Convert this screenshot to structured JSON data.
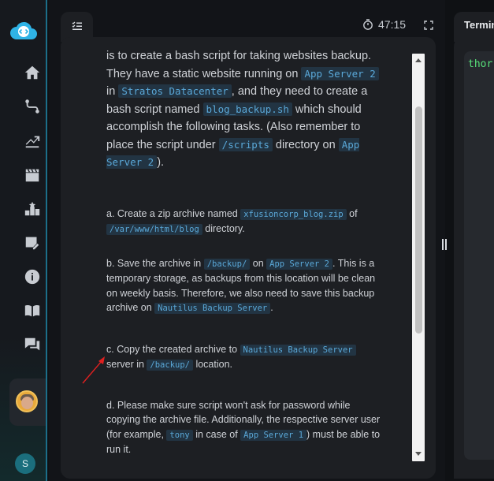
{
  "header": {
    "timer": "47:15",
    "terminal_tab_label": "Terminal"
  },
  "terminal": {
    "prompt_fragment": "thor"
  },
  "sidebar": {
    "user_initial": "S",
    "icons": [
      "home-icon",
      "route-icon",
      "chart-icon",
      "clapperboard-icon",
      "leaderboard-icon",
      "notes-icon",
      "info-icon",
      "book-icon",
      "chat-icon"
    ]
  },
  "task": {
    "intro": {
      "t1": "is to create a bash script for taking websites backup. They have a static website running on ",
      "c1": "App Server 2",
      "t2": " in ",
      "c2": "Stratos Datacenter",
      "t3": ", and they need to create a bash script named ",
      "c3": "blog_backup.sh",
      "t4": " which should accomplish the following tasks. (Also remember to place the script under ",
      "c4": "/scripts",
      "t5": " directory on ",
      "c5": "App Server 2",
      "t6": ")."
    },
    "a": {
      "t1": "a. Create a zip archive named ",
      "c1": "xfusioncorp_blog.zip",
      "t2": " of ",
      "c2": "/var/www/html/blog",
      "t3": " directory."
    },
    "b": {
      "t1": "b. Save the archive in ",
      "c1": "/backup/",
      "t2": " on ",
      "c2": "App Server 2",
      "t3": ". This is a temporary storage, as backups from this location will be clean on weekly basis. Therefore, we also need to save this backup archive on ",
      "c3": "Nautilus Backup Server",
      "t4": "."
    },
    "c": {
      "t1": "c. Copy the created archive to ",
      "c1": "Nautilus Backup Server",
      "t2": " server in ",
      "c2": "/backup/",
      "t3": " location."
    },
    "d": {
      "t1": "d. Please make sure script won't ask for password while copying the archive file. Additionally, the respective server user (for example, ",
      "c1": "tony",
      "t2": " in case of ",
      "c2": "App Server 1",
      "t3": ") must be able to run it."
    }
  }
}
